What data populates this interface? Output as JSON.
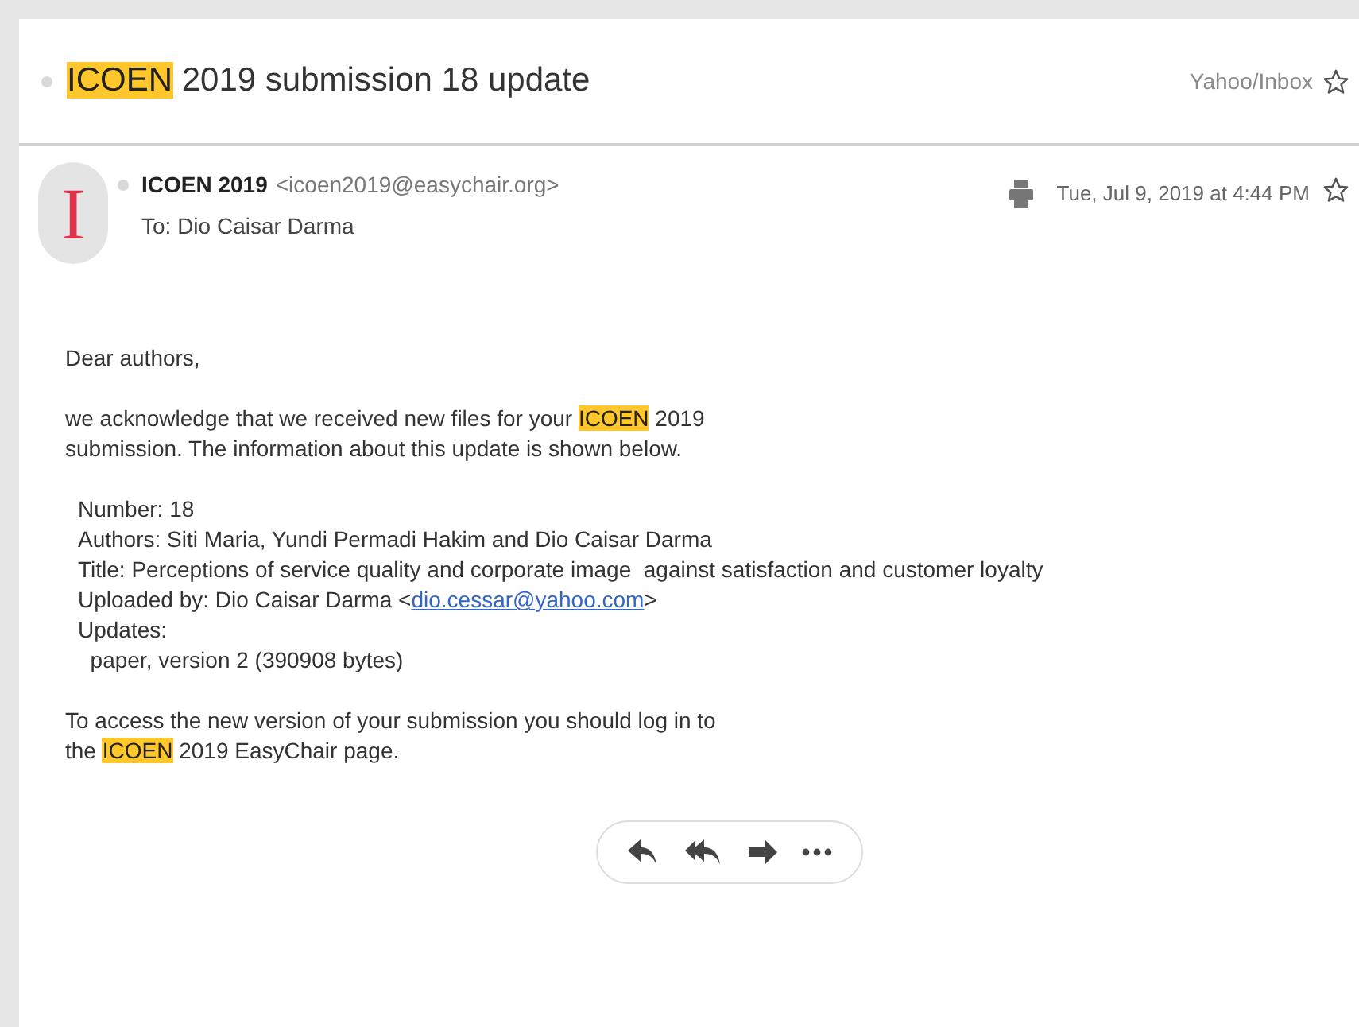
{
  "subject": [
    {
      "kind": "highlight",
      "text": "ICOEN"
    },
    {
      "kind": "text",
      "text": " 2019 submission 18 update"
    }
  ],
  "folder": "Yahoo/Inbox",
  "sender": {
    "avatar_letter": "I",
    "name": "ICOEN 2019",
    "email": "<icoen2019@easychair.org>",
    "to": "To: Dio Caisar Darma",
    "date": "Tue, Jul 9, 2019 at 4:44 PM"
  },
  "body": [
    {
      "kind": "paragraph",
      "lines": [
        [
          {
            "kind": "text",
            "text": "Dear authors,"
          }
        ]
      ]
    },
    {
      "kind": "paragraph",
      "lines": [
        [
          {
            "kind": "text",
            "text": "we acknowledge that we received new files for your "
          },
          {
            "kind": "highlight",
            "text": "ICOEN"
          },
          {
            "kind": "text",
            "text": " 2019"
          }
        ],
        [
          {
            "kind": "text",
            "text": "submission. The information about this update is shown below."
          }
        ]
      ]
    },
    {
      "kind": "details",
      "lines": [
        [
          {
            "kind": "text",
            "text": "Number: 18"
          }
        ],
        [
          {
            "kind": "text",
            "text": "Authors: Siti Maria, Yundi Permadi Hakim and Dio Caisar Darma"
          }
        ],
        [
          {
            "kind": "text",
            "text": "Title: Perceptions of service quality and corporate image  against satisfaction and customer loyalty"
          }
        ],
        [
          {
            "kind": "text",
            "text": "Uploaded by: Dio Caisar Darma <"
          },
          {
            "kind": "link",
            "text": "dio.cessar@yahoo.com"
          },
          {
            "kind": "text",
            "text": ">"
          }
        ],
        [
          {
            "kind": "text",
            "text": "Updates:"
          }
        ],
        [
          {
            "kind": "text",
            "text": "  paper, version 2 (390908 bytes)"
          }
        ]
      ]
    },
    {
      "kind": "paragraph",
      "lines": [
        [
          {
            "kind": "text",
            "text": "To access the new version of your submission you should log in to"
          }
        ],
        [
          {
            "kind": "text",
            "text": "the "
          },
          {
            "kind": "highlight",
            "text": "ICOEN"
          },
          {
            "kind": "text",
            "text": " 2019 EasyChair page."
          }
        ]
      ]
    }
  ]
}
